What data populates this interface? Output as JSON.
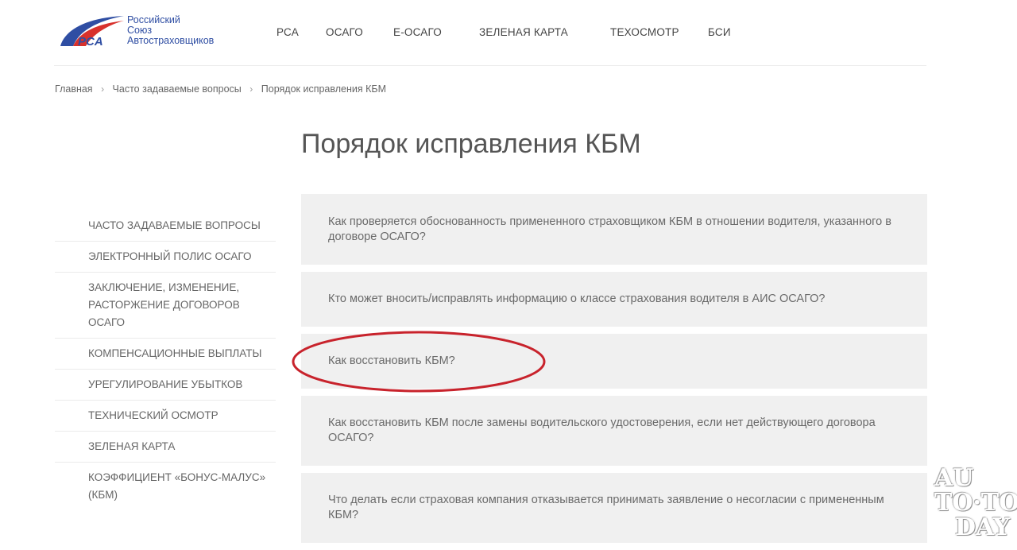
{
  "logo": {
    "mark_text": "PCA",
    "line1": "Российский",
    "line2": "Союз",
    "line3": "Автостраховщиков",
    "colors": {
      "blue": "#2f4ea3",
      "red": "#d8312c"
    }
  },
  "nav": [
    {
      "label": "РСА"
    },
    {
      "label": "ОСАГО"
    },
    {
      "label": "Е-ОСАГО"
    },
    {
      "label": "ЗЕЛЕНАЯ КАРТА"
    },
    {
      "label": "ТЕХОСМОТР"
    },
    {
      "label": "БСИ"
    }
  ],
  "breadcrumb": {
    "items": [
      "Главная",
      "Часто задаваемые вопросы",
      "Порядок исправления КБМ"
    ],
    "separator": "›"
  },
  "page_title": "Порядок исправления КБМ",
  "sidebar": [
    {
      "label": "ЧАСТО ЗАДАВАЕМЫЕ ВОПРОСЫ"
    },
    {
      "label": "ЭЛЕКТРОННЫЙ ПОЛИС ОСАГО"
    },
    {
      "label": "ЗАКЛЮЧЕНИЕ, ИЗМЕНЕНИЕ, РАСТОРЖЕНИЕ ДОГОВОРОВ ОСАГО"
    },
    {
      "label": "КОМПЕНСАЦИОННЫЕ ВЫПЛАТЫ"
    },
    {
      "label": "УРЕГУЛИРОВАНИЕ УБЫТКОВ"
    },
    {
      "label": "ТЕХНИЧЕСКИЙ ОСМОТР"
    },
    {
      "label": "ЗЕЛЕНАЯ КАРТА"
    },
    {
      "label": "КОЭФФИЦИЕНТ «БОНУС-МАЛУС» (КБМ)"
    }
  ],
  "faq": [
    {
      "question": "Как проверяется обоснованность примененного страховщиком КБМ в отношении водителя, указанного в договоре ОСАГО?"
    },
    {
      "question": "Кто может вносить/исправлять информацию о классе страхования водителя в АИС ОСАГО?"
    },
    {
      "question": "Как восстановить КБМ?"
    },
    {
      "question": "Как восстановить КБМ после замены водительского удостоверения, если нет действующего договора ОСАГО?"
    },
    {
      "question": "Что делать если страховая компания отказывается принимать заявление о несогласии с примененным КБМ?"
    }
  ],
  "highlight_color": "#c8232c",
  "watermark": {
    "line1": "AU",
    "line2": "TO·TO",
    "line3": "DAY"
  }
}
